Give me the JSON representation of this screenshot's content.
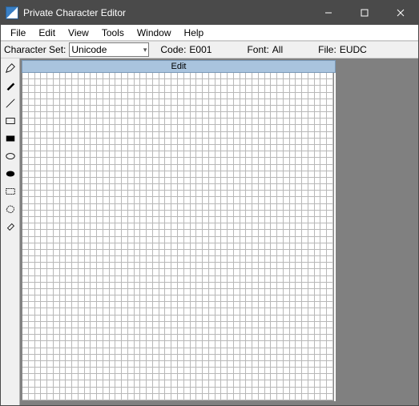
{
  "titlebar": {
    "app_title": "Private Character Editor"
  },
  "menu": {
    "file": "File",
    "edit": "Edit",
    "view": "View",
    "tools": "Tools",
    "window": "Window",
    "help": "Help"
  },
  "status": {
    "charset_label": "Character Set:",
    "charset_value": "Unicode",
    "code_label": "Code:",
    "code_value": "E001",
    "font_label": "Font:",
    "font_value": "All",
    "file_label": "File:",
    "file_value": "EUDC"
  },
  "edit_panel": {
    "header": "Edit",
    "grid_size": 50
  },
  "tools": {
    "pencil": "pencil-tool",
    "brush": "brush-tool",
    "line": "line-tool",
    "rect_outline": "rectangle-outline-tool",
    "rect_fill": "rectangle-fill-tool",
    "ellipse_outline": "ellipse-outline-tool",
    "ellipse_fill": "ellipse-fill-tool",
    "select_rect": "rectangular-select-tool",
    "select_free": "freeform-select-tool",
    "eraser": "eraser-tool"
  }
}
